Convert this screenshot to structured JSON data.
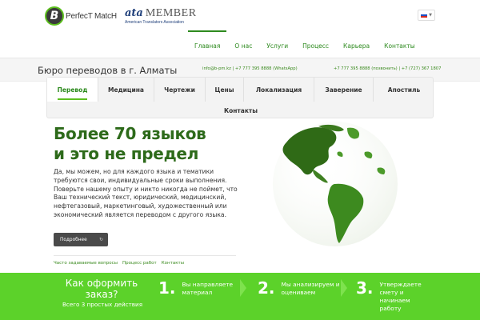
{
  "header": {
    "logo_letter": "B",
    "logo_text": "PerfecT MatcH",
    "ata_mark": "ata",
    "ata_member": "MEMBER",
    "ata_sub": "American Translators Association",
    "language_flag": "ru-flag"
  },
  "nav": {
    "items": [
      "Главная",
      "О нас",
      "Услуги",
      "Процесс",
      "Карьера",
      "Контакты"
    ]
  },
  "infobar": {
    "title": "Бюро переводов в г. Алматы",
    "contact_email_whatsapp": "info@b-pm.kz | +7 777 395 8888 (WhatsApp)",
    "contact_phones": "+7 777 395 8888 (позвонить) | +7 (727) 367 1807"
  },
  "tabs": {
    "items": [
      "Перевод",
      "Медицина",
      "Чертежи",
      "Цены",
      "Локализация",
      "Заверение",
      "Апостиль"
    ],
    "second_row": "Контакты",
    "active": "Перевод"
  },
  "main": {
    "headline_line1": "Более 70 языков",
    "headline_line2": "и это не предел",
    "paragraph": "Да, мы можем, но для каждого языка и тематики требуются свои, индивидуальные сроки выполнения. Поверьте нашему опыту и никто никогда не поймет, что Ваш технический текст, юридический, медицинский, нефтегазовый, маркетинговый, художественный или экономический является переводом с другого языка.",
    "more_button": "Подробнее",
    "links": [
      "Часто задаваемые вопросы",
      "Процесс работ",
      "Контакты"
    ]
  },
  "howto": {
    "title": "Как оформить заказ?",
    "subtitle": "Всего 3 простых действия",
    "steps": [
      {
        "num": "1.",
        "text": "Вы направляете материал"
      },
      {
        "num": "2.",
        "text": "Мы анализируем и оцениваем"
      },
      {
        "num": "3.",
        "text": "Утверждаете смету и начинаем работу"
      }
    ]
  },
  "colors": {
    "brand_green": "#2d8a1e",
    "accent_green": "#5cd22a",
    "dark_button": "#4a4a4a"
  }
}
